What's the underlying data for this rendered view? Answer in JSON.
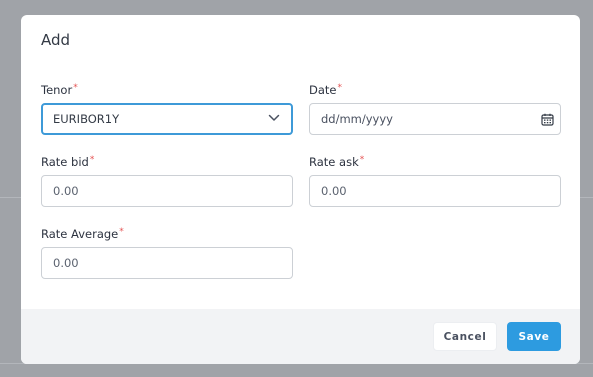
{
  "dialog": {
    "title": "Add"
  },
  "fields": {
    "tenor": {
      "label": "Tenor",
      "required_mark": "*",
      "value": "EURIBOR1Y"
    },
    "date": {
      "label": "Date",
      "required_mark": "*",
      "placeholder": "dd/mm/yyyy"
    },
    "rate_bid": {
      "label": "Rate bid",
      "required_mark": "*",
      "placeholder": "0.00"
    },
    "rate_ask": {
      "label": "Rate ask",
      "required_mark": "*",
      "placeholder": "0.00"
    },
    "rate_average": {
      "label": "Rate Average",
      "required_mark": "*",
      "placeholder": "0.00"
    }
  },
  "footer": {
    "cancel_label": "Cancel",
    "save_label": "Save"
  },
  "icons": {
    "tenor_dropdown": "chevron-down-icon",
    "date_picker": "calendar-icon"
  },
  "colors": {
    "accent": "#2d9be0",
    "required": "#e55353",
    "focus_border": "#3e9ad8"
  }
}
